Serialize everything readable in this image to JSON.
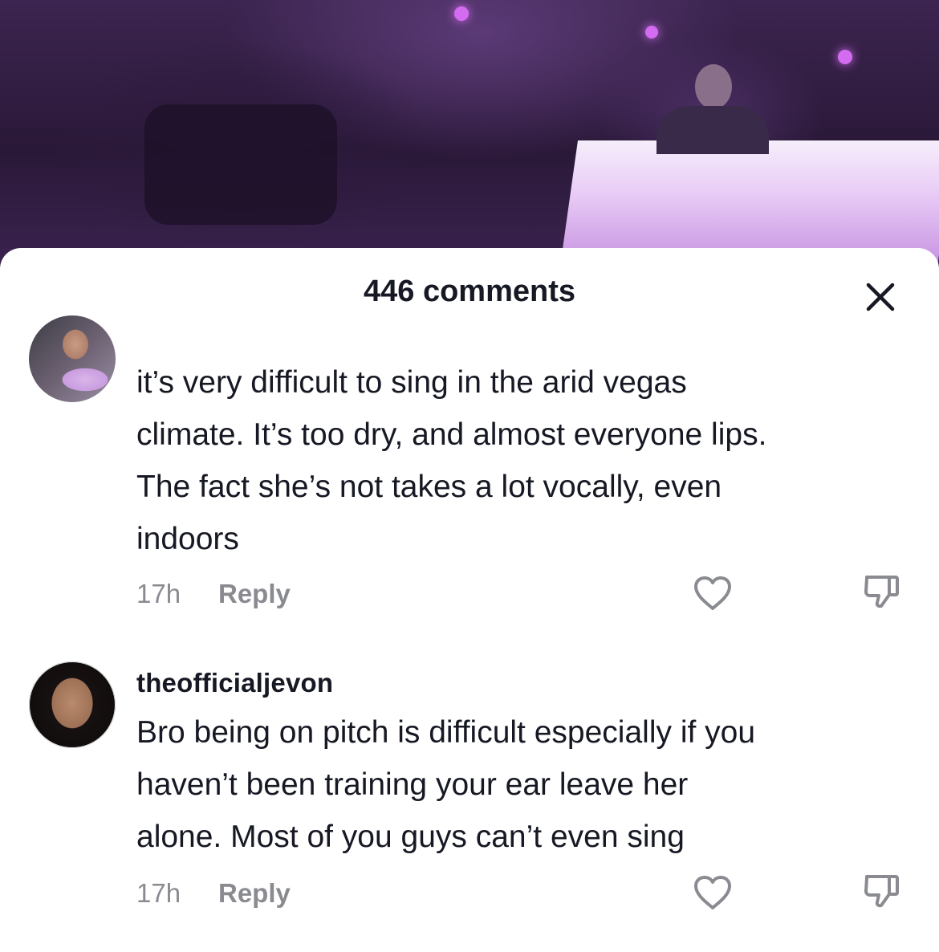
{
  "sheet": {
    "comment_count": "446 comments"
  },
  "comments": [
    {
      "username": "",
      "text": "it’s very difficult to sing in the arid vegas\nclimate. It’s too dry, and almost everyone lips.\nThe fact she’s not takes a lot vocally, even\nindoors",
      "time": "17h",
      "reply_label": "Reply",
      "avatar_icon": "user-avatar"
    },
    {
      "username": "theofficialjevon",
      "text": "Bro being on pitch is difficult especially if you\nhaven’t been training your ear leave her\nalone. Most of you guys can’t even sing",
      "time": "17h",
      "reply_label": "Reply",
      "avatar_icon": "user-avatar"
    }
  ],
  "icons": {
    "close": "close-icon",
    "like": "heart-outline-icon",
    "dislike": "thumbs-down-outline-icon"
  },
  "colors": {
    "text_primary": "#161823",
    "text_secondary": "#8a8b91",
    "sheet_bg": "#ffffff"
  }
}
